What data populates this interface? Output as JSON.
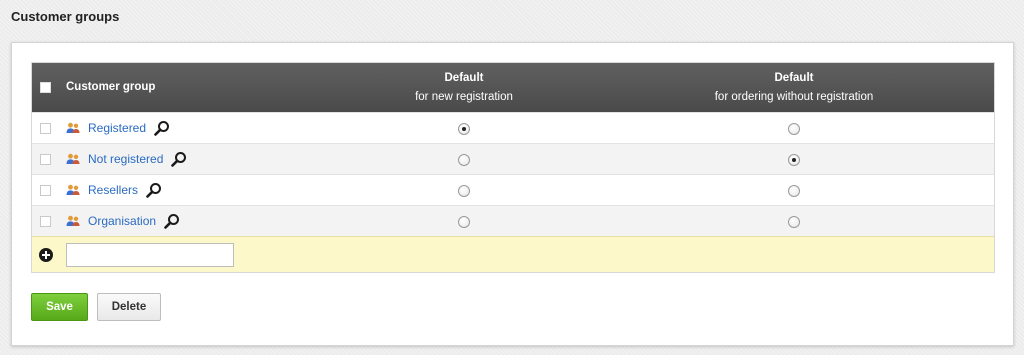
{
  "page": {
    "title": "Customer groups"
  },
  "table": {
    "headers": {
      "customer_group": "Customer group",
      "default_new_line1": "Default",
      "default_new_line2": "for new registration",
      "default_order_line1": "Default",
      "default_order_line2": "for ordering without registration"
    },
    "rows": [
      {
        "name": "Registered",
        "default_new": true,
        "default_order": false
      },
      {
        "name": "Not registered",
        "default_new": false,
        "default_order": true
      },
      {
        "name": "Resellers",
        "default_new": false,
        "default_order": false
      },
      {
        "name": "Organisation",
        "default_new": false,
        "default_order": false
      }
    ],
    "new_row": {
      "value": "",
      "placeholder": ""
    }
  },
  "actions": {
    "save_label": "Save",
    "delete_label": "Delete"
  },
  "colors": {
    "link": "#2a6bc2",
    "header_bg": "#4f4f4f",
    "new_row_bg": "#fdf8c9",
    "save_bg": "#66b92a"
  },
  "icons": {
    "group": "users-icon",
    "view": "magnifier-icon",
    "add": "add-circle-icon"
  }
}
